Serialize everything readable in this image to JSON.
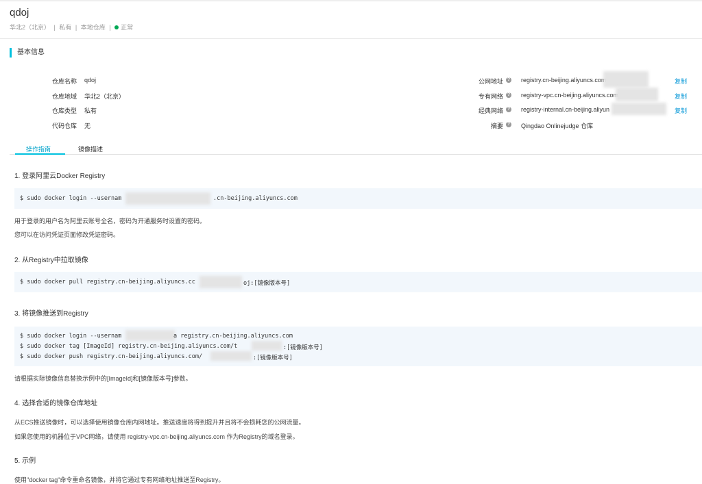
{
  "header": {
    "title": "qdoj",
    "region": "华北2（北京）",
    "visibility": "私有",
    "repo_kind": "本地仓库",
    "status": "正常",
    "status_color": "#00a854"
  },
  "section_title": "基本信息",
  "info_left": [
    {
      "label": "仓库名称",
      "value": "qdoj"
    },
    {
      "label": "仓库地域",
      "value": "华北2（北京）"
    },
    {
      "label": "仓库类型",
      "value": "私有"
    },
    {
      "label": "代码仓库",
      "value": "无"
    }
  ],
  "info_right": [
    {
      "label": "公网地址",
      "value": "registry.cn-beijing.aliyuncs.com",
      "copy": "复制"
    },
    {
      "label": "专有网络",
      "value": "registry-vpc.cn-beijing.aliyuncs.com",
      "copy": "复制"
    },
    {
      "label": "经典网络",
      "value": "registry-internal.cn-beijing.aliyun",
      "copy": "复制"
    },
    {
      "label": "摘要",
      "value": "Qingdao Onlinejudge 仓库"
    }
  ],
  "tabs": [
    {
      "label": "操作指南",
      "active": true
    },
    {
      "label": "镜像描述",
      "active": false
    }
  ],
  "guide": {
    "step1": {
      "title": "1. 登录阿里云Docker Registry",
      "code": [
        "$ sudo docker login --usernam",
        ".cn-beijing.aliyuncs.com"
      ],
      "notes": [
        "用于登录的用户名为阿里云账号全名，密码为开通服务时设置的密码。",
        "您可以在访问凭证页面修改凭证密码。"
      ]
    },
    "step2": {
      "title": "2. 从Registry中拉取镜像",
      "code": [
        "$ sudo docker pull registry.cn-beijing.aliyuncs.cc",
        "oj:[镜像版本号]"
      ]
    },
    "step3": {
      "title": "3. 将镜像推送到Registry",
      "code": [
        [
          "$ sudo docker login --usernam",
          "a registry.cn-beijing.aliyuncs.com"
        ],
        [
          "$ sudo docker tag [ImageId] registry.cn-beijing.aliyuncs.com/t",
          ":[镜像版本号]"
        ],
        [
          "$ sudo docker push registry.cn-beijing.aliyuncs.com/",
          ":[镜像版本号]"
        ]
      ],
      "notes": [
        "请根据实际镜像信息替换示例中的[ImageId]和[镜像版本号]参数。"
      ]
    },
    "step4": {
      "title": "4. 选择合适的镜像仓库地址",
      "notes": [
        "从ECS推送镜像时，可以选择使用镜像仓库内网地址。推送速度将得到提升并且将不会损耗您的公网流量。",
        "如果您使用的机器位于VPC网络，请使用 registry-vpc.cn-beijing.aliyuncs.com 作为Registry的域名登录。"
      ]
    },
    "step5": {
      "title": "5. 示例",
      "notes": [
        "使用\"docker tag\"命令重命名镜像，并将它通过专有网络地址推送至Registry。"
      ]
    }
  }
}
